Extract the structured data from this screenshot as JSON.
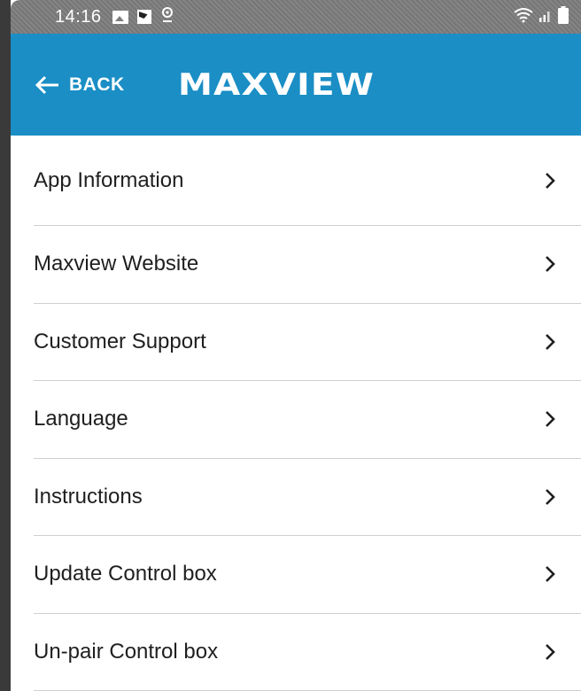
{
  "status_bar": {
    "time": "14:16",
    "left_icons": [
      "image-icon",
      "photo-icon",
      "location-icon"
    ],
    "right_icons": [
      "wifi-icon",
      "signal-icon",
      "battery-icon"
    ]
  },
  "header": {
    "back_label": "BACK",
    "logo_text": "MAXVIEW",
    "background_color": "#1a8ec5"
  },
  "menu": {
    "items": [
      {
        "label": "App Information"
      },
      {
        "label": "Maxview Website"
      },
      {
        "label": "Customer Support"
      },
      {
        "label": "Language"
      },
      {
        "label": "Instructions"
      },
      {
        "label": "Update Control box"
      },
      {
        "label": "Un-pair Control box"
      }
    ]
  }
}
